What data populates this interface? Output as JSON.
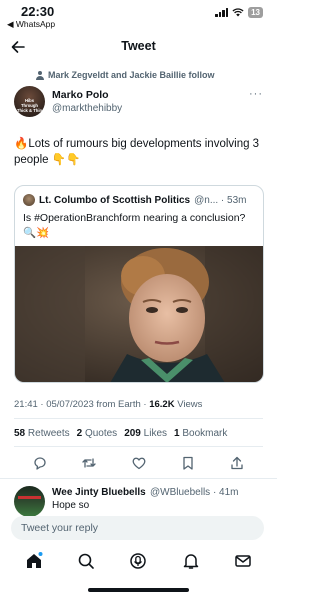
{
  "status_bar": {
    "time": "22:30",
    "back_app": "◀ WhatsApp",
    "battery": "13"
  },
  "header": {
    "title": "Tweet",
    "back_icon": "arrow-left-icon"
  },
  "social_context": {
    "text": "Mark Zegveldt and Jackie Baillie follow"
  },
  "author": {
    "name": "Marko Polo",
    "handle": "@markthehibby",
    "avatar_text": "Hibs Through Thick & Thin"
  },
  "tweet": {
    "text": "🔥Lots of rumours big developments involving 3 people 👇👇"
  },
  "quoted_tweet": {
    "name": "Lt. Columbo of Scottish Politics",
    "handle_time": "@n... · 53m",
    "text": "Is #OperationBranchform nearing a conclusion? 🔍💥"
  },
  "meta": {
    "timestamp": "21:41 · 05/07/2023 from Earth · ",
    "views_count": "16.2K",
    "views_label": " Views"
  },
  "stats": {
    "retweets_count": "58",
    "retweets_label": "Retweets",
    "quotes_count": "2",
    "quotes_label": "Quotes",
    "likes_count": "209",
    "likes_label": "Likes",
    "bookmarks_count": "1",
    "bookmarks_label": "Bookmark"
  },
  "actions": [
    "reply-icon",
    "retweet-icon",
    "like-icon",
    "bookmark-icon",
    "share-icon"
  ],
  "reply_preview": {
    "name": "Wee Jinty Bluebells",
    "handle_time": "@WBluebells · 41m",
    "text": "Hope so"
  },
  "composer": {
    "placeholder": "Tweet your reply"
  },
  "bottom_nav": [
    "home-icon",
    "search-icon",
    "spaces-icon",
    "notifications-icon",
    "messages-icon"
  ],
  "colors": {
    "accent": "#1d9bf0",
    "text": "#0f1419",
    "secondary": "#536471",
    "border": "#cfd9de"
  }
}
